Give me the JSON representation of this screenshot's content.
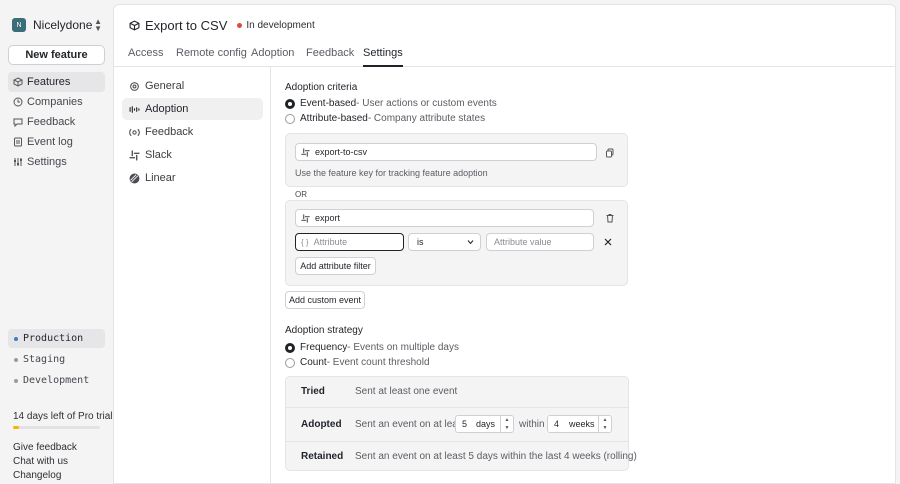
{
  "sidebar": {
    "org_initial": "N",
    "org_name": "Nicelydone",
    "new_feature_label": "New feature",
    "nav": [
      {
        "label": "Features",
        "icon": "box-icon",
        "active": true
      },
      {
        "label": "Companies",
        "icon": "building-icon",
        "active": false
      },
      {
        "label": "Feedback",
        "icon": "chat-icon",
        "active": false
      },
      {
        "label": "Event log",
        "icon": "list-icon",
        "active": false
      },
      {
        "label": "Settings",
        "icon": "sliders-icon",
        "active": false
      }
    ],
    "environments": [
      {
        "label": "Production",
        "active": true
      },
      {
        "label": "Staging",
        "active": false
      },
      {
        "label": "Development",
        "active": false
      }
    ],
    "trial_text": "14 days left of Pro trial",
    "trial_progress": 0.07,
    "footer_links": [
      "Give feedback",
      "Chat with us",
      "Changelog"
    ]
  },
  "header": {
    "title": "Export to CSV",
    "status": "In development",
    "status_color": "#e0493c",
    "tabs": [
      {
        "label": "Access",
        "active": false
      },
      {
        "label": "Remote config",
        "active": false
      },
      {
        "label": "Adoption",
        "active": false
      },
      {
        "label": "Feedback",
        "active": false
      },
      {
        "label": "Settings",
        "active": true
      }
    ]
  },
  "subnav": [
    {
      "label": "General",
      "icon": "gear-icon",
      "active": false
    },
    {
      "label": "Adoption",
      "icon": "adoption-icon",
      "active": true
    },
    {
      "label": "Feedback",
      "icon": "feedback-icon",
      "active": false
    },
    {
      "label": "Slack",
      "icon": "slack-icon",
      "active": false
    },
    {
      "label": "Linear",
      "icon": "linear-icon",
      "active": false
    }
  ],
  "criteria": {
    "heading": "Adoption criteria",
    "options": [
      {
        "label": "Event-based",
        "desc": " - User actions or custom events",
        "selected": true
      },
      {
        "label": "Attribute-based",
        "desc": " - Company attribute states",
        "selected": false
      }
    ],
    "feature_key": "export-to-csv",
    "feature_key_hint": "Use the feature key for tracking feature adoption",
    "or_label": "OR",
    "event_name": "export",
    "attribute_placeholder": "Attribute",
    "operator": "is",
    "value_placeholder": "Attribute value",
    "add_filter_label": "Add attribute filter",
    "add_event_label": "Add custom event"
  },
  "strategy": {
    "heading": "Adoption strategy",
    "options": [
      {
        "label": "Frequency",
        "desc": " - Events on multiple days",
        "selected": true
      },
      {
        "label": "Count",
        "desc": " - Event count threshold",
        "selected": false
      }
    ],
    "rows": {
      "tried": {
        "key": "Tried",
        "text": "Sent at least one event"
      },
      "adopted": {
        "key": "Adopted",
        "prefix": "Sent an event on at least",
        "days_value": "5",
        "days_unit": "days",
        "within": "within",
        "weeks_value": "4",
        "weeks_unit": "weeks"
      },
      "retained": {
        "key": "Retained",
        "text": "Sent an event on at least 5 days within the last 4 weeks (rolling)"
      }
    }
  }
}
